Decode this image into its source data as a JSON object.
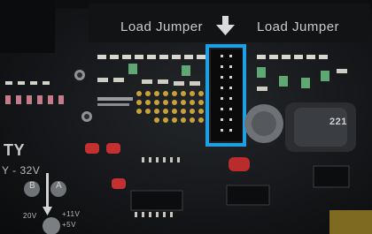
{
  "silkscreen": {
    "load_jumper_left": "Load Jumper",
    "load_jumper_right": "Load Jumper",
    "ty": "TY",
    "voltage_range": "Y - 32V",
    "label_b": "B",
    "label_a": "A",
    "v20": "20V",
    "v11": "+11V",
    "v5": "+5V",
    "inductor_code": "221"
  },
  "highlight": {
    "color": "#1ea0e6"
  },
  "colors": {
    "board": "#17191c",
    "pin_header": "#0a0a0b",
    "gold_pads": "#c9a23a",
    "red_caps": "#c23030"
  }
}
